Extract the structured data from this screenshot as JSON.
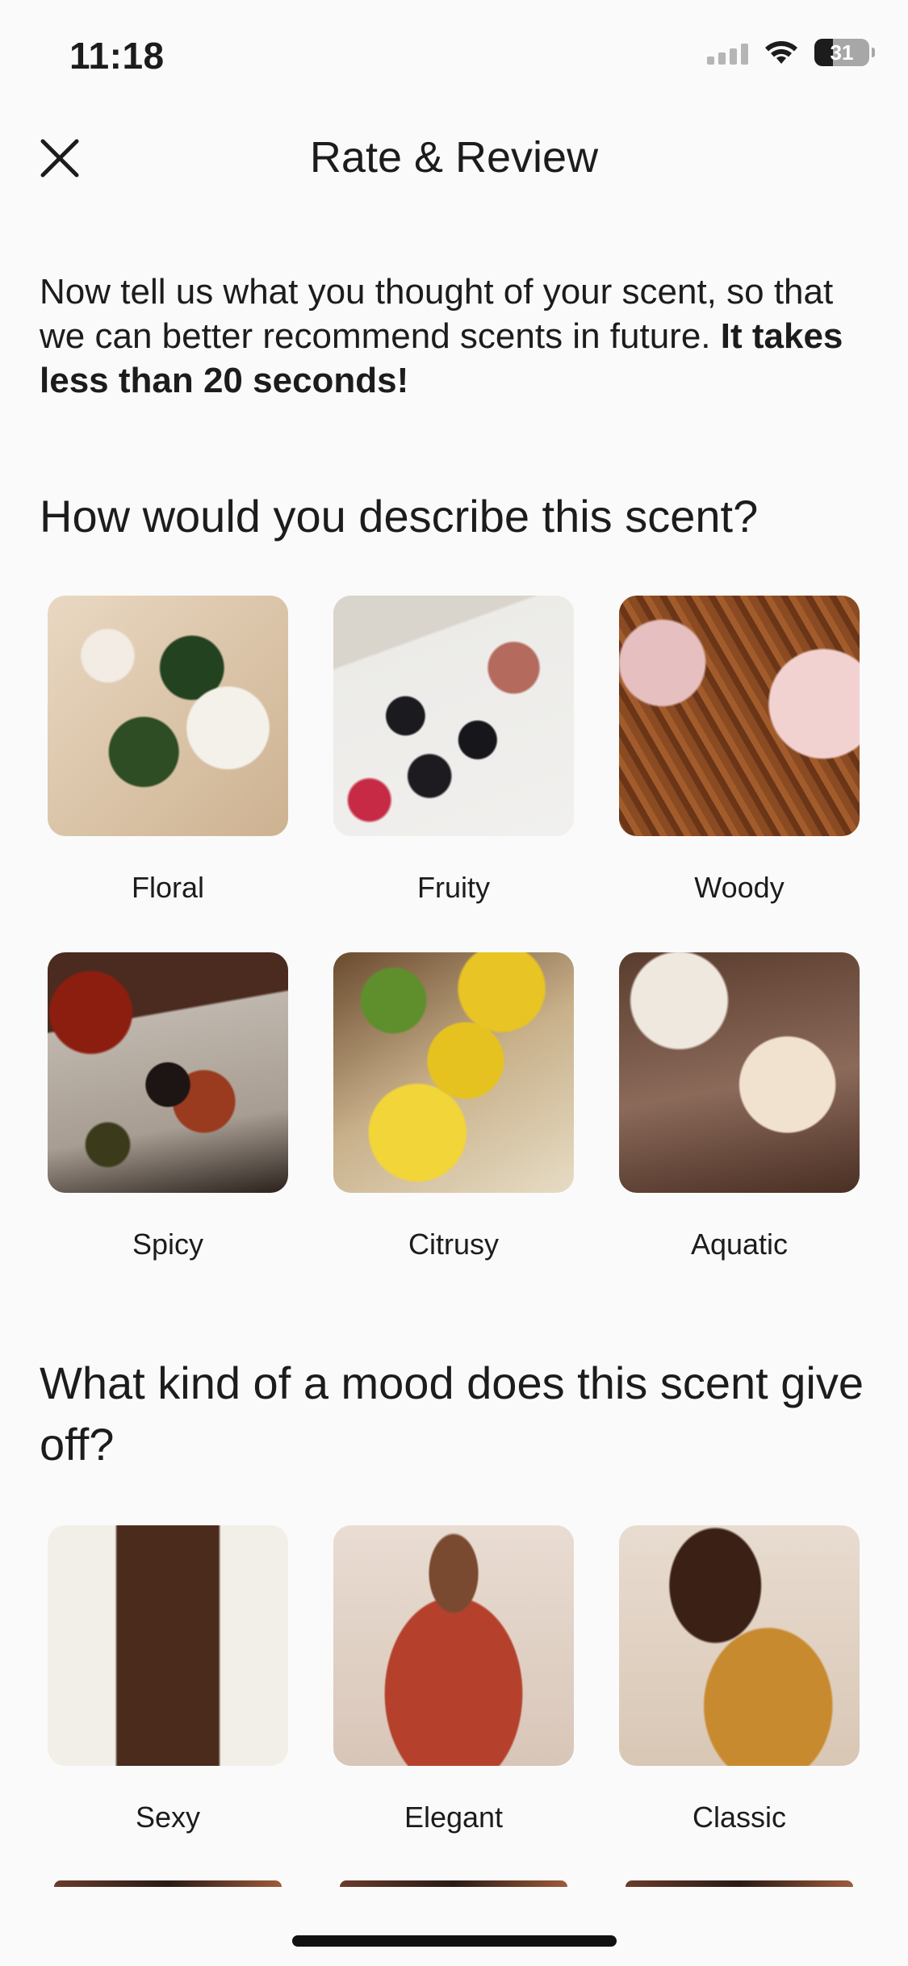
{
  "status_bar": {
    "time": "11:18",
    "battery": "31"
  },
  "nav": {
    "title": "Rate & Review",
    "close_icon": "close-icon"
  },
  "intro": {
    "text": "Now tell us what you thought of your scent, so that we can better recommend scents in future.",
    "bold": "It takes less than 20 seconds!"
  },
  "scent_section": {
    "heading": "How would you describe this scent?",
    "options": [
      {
        "label": "Floral"
      },
      {
        "label": "Fruity"
      },
      {
        "label": "Woody"
      },
      {
        "label": "Spicy"
      },
      {
        "label": "Citrusy"
      },
      {
        "label": "Aquatic"
      }
    ]
  },
  "mood_section": {
    "heading": "What kind of a mood does this scent give off?",
    "options": [
      {
        "label": "Sexy"
      },
      {
        "label": "Elegant"
      },
      {
        "label": "Classic"
      }
    ]
  }
}
